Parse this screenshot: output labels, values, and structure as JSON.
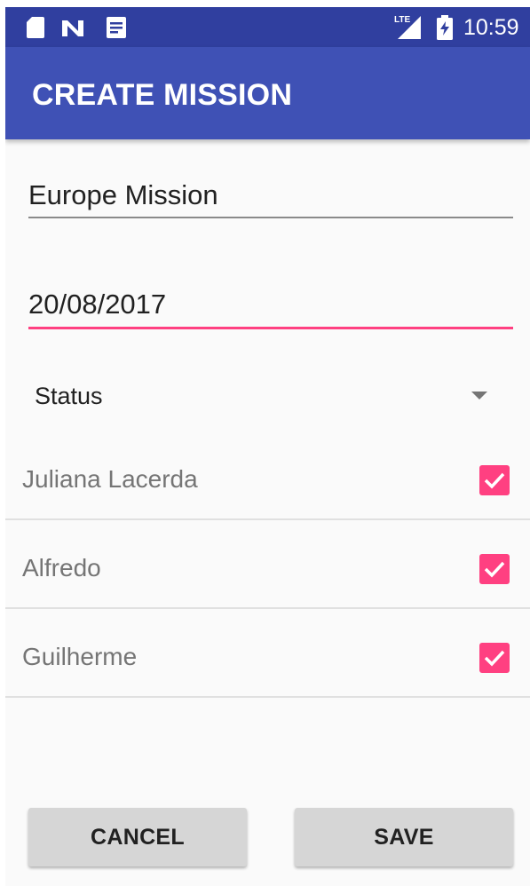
{
  "status_bar": {
    "time": "10:59",
    "network_label": "LTE",
    "icons": [
      "sd-card-icon",
      "n-notification-icon",
      "document-icon",
      "lte-signal-icon",
      "battery-charging-icon"
    ]
  },
  "toolbar": {
    "title": "CREATE MISSION"
  },
  "form": {
    "mission_name": {
      "value": "Europe Mission"
    },
    "mission_date": {
      "value": "20/08/2017"
    },
    "status_spinner": {
      "selected": "Status"
    }
  },
  "members": [
    {
      "name": "Juliana Lacerda",
      "checked": true
    },
    {
      "name": "Alfredo",
      "checked": true
    },
    {
      "name": "Guilherme",
      "checked": true
    }
  ],
  "actions": {
    "cancel_label": "CANCEL",
    "save_label": "SAVE"
  },
  "colors": {
    "status_bar": "#303f9f",
    "toolbar": "#3f51b5",
    "accent": "#ff4081",
    "button": "#d6d6d6"
  }
}
